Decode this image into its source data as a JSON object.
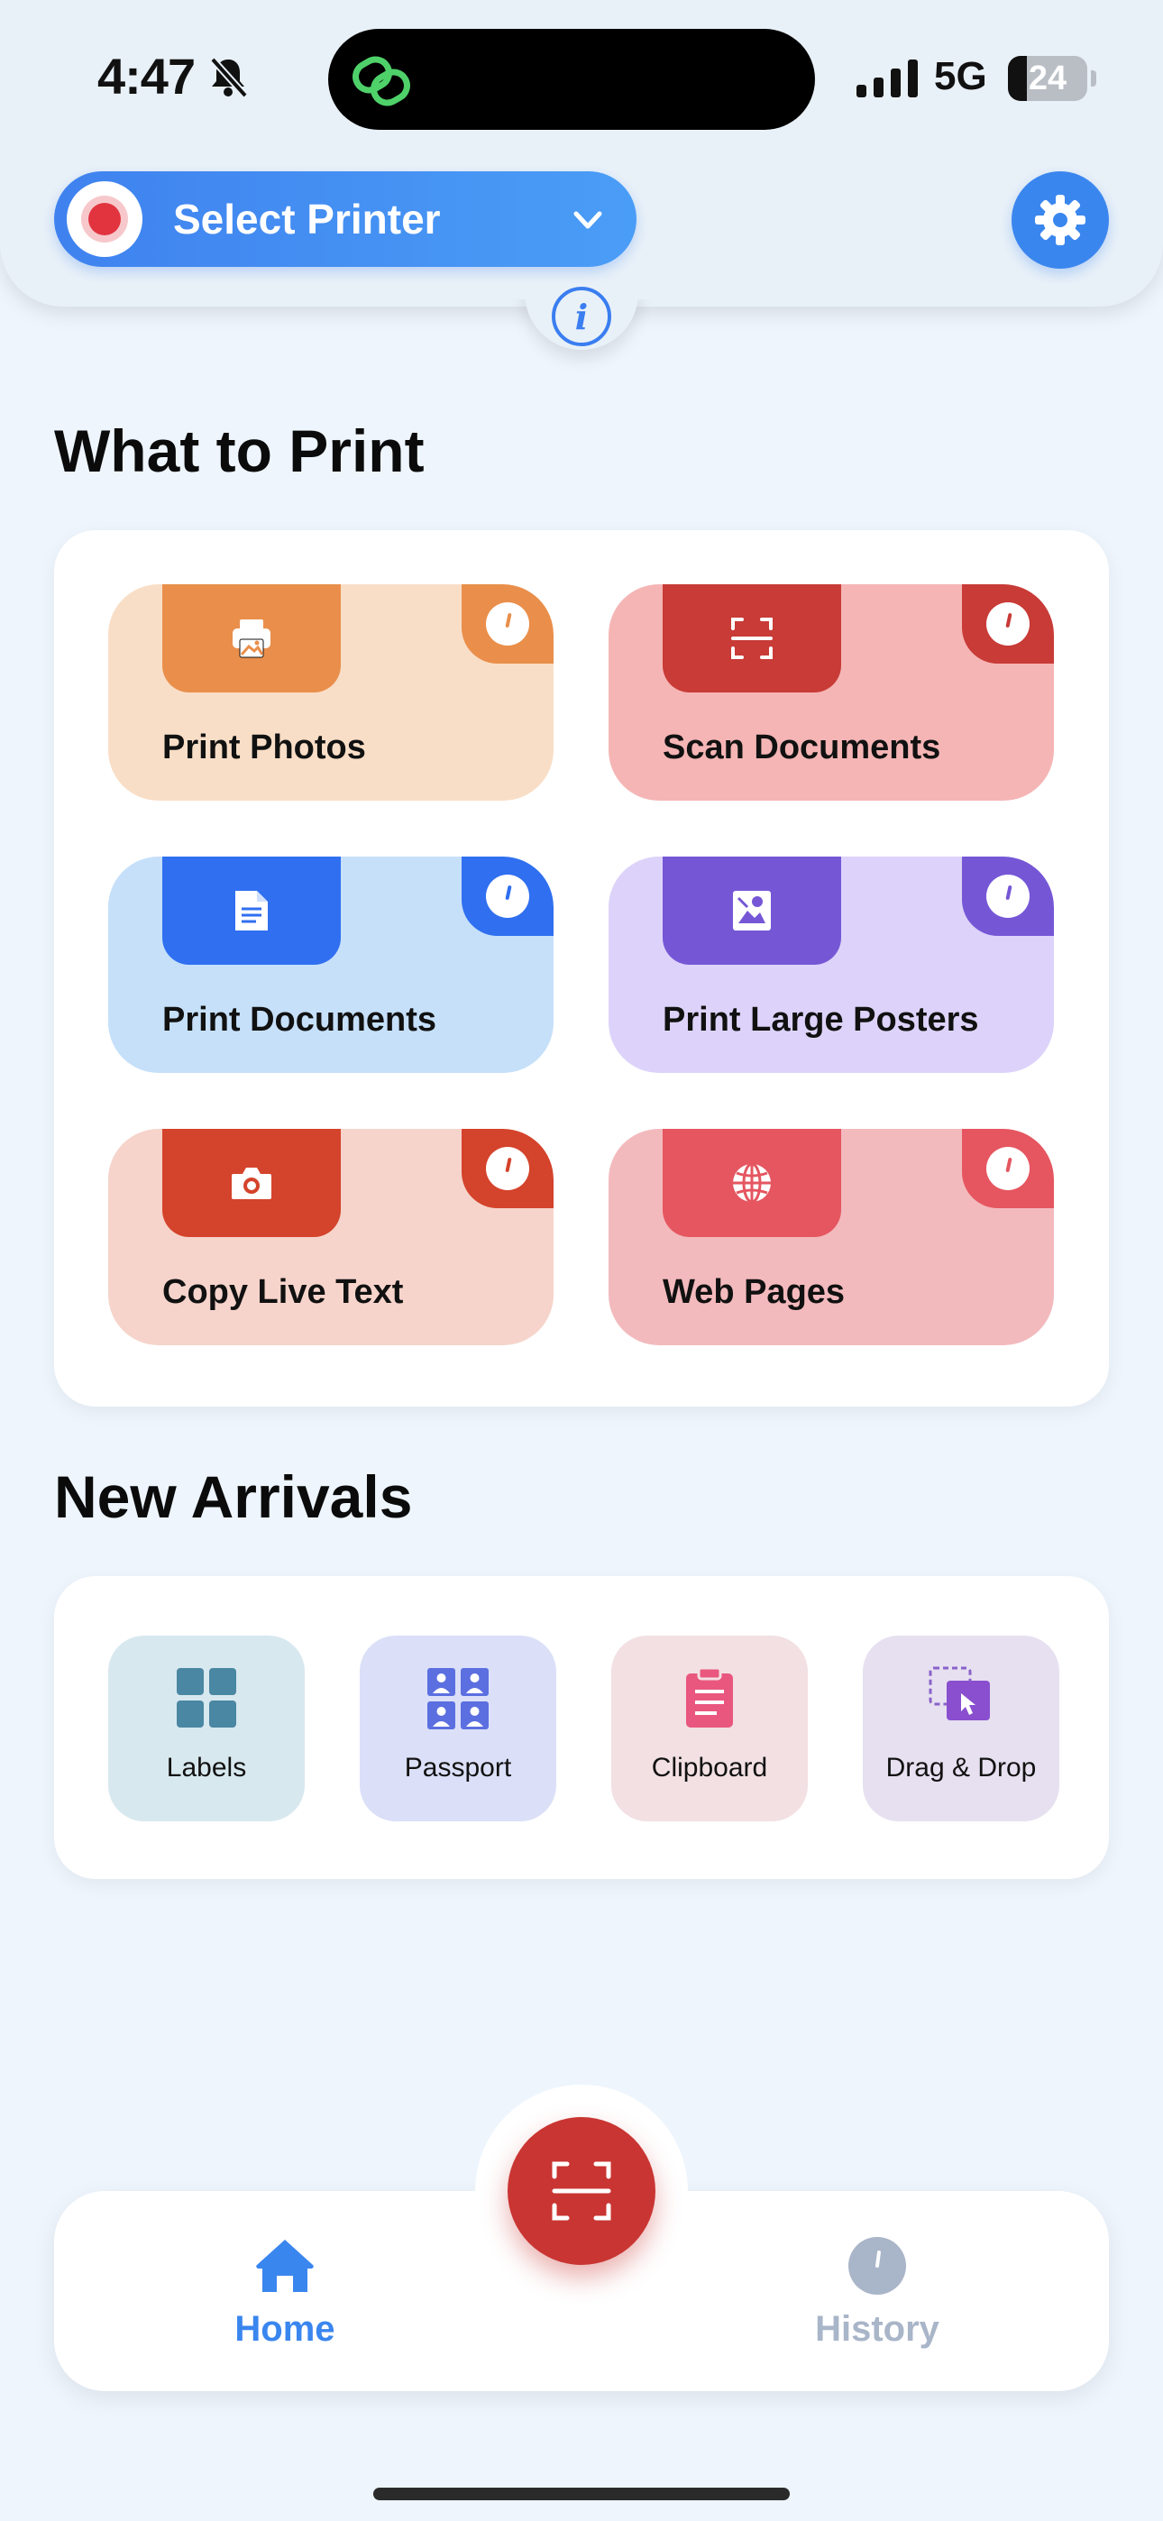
{
  "status_bar": {
    "time": "4:47",
    "network": "5G",
    "battery": "24"
  },
  "header": {
    "printer_label": "Select Printer"
  },
  "what_to_print": {
    "title": "What to Print",
    "cards": [
      {
        "label": "Print Photos",
        "icon": "printer-photo-icon",
        "bg": "#f9dec7",
        "accent": "#e98f4b"
      },
      {
        "label": "Scan Documents",
        "icon": "scan-icon",
        "bg": "#f5b5b5",
        "accent": "#c83b37"
      },
      {
        "label": "Print Documents",
        "icon": "document-icon",
        "bg": "#c6e0fa",
        "accent": "#2f6ff0"
      },
      {
        "label": "Print Large Posters",
        "icon": "poster-icon",
        "bg": "#ddd3fa",
        "accent": "#7557d6"
      },
      {
        "label": "Copy Live Text",
        "icon": "camera-icon",
        "bg": "#f6d4cb",
        "accent": "#d4432b"
      },
      {
        "label": "Web Pages",
        "icon": "globe-icon",
        "bg": "#f3babd",
        "accent": "#e55660"
      }
    ]
  },
  "new_arrivals": {
    "title": "New Arrivals",
    "items": [
      {
        "label": "Labels",
        "icon": "grid-icon",
        "bg": "#d8e8ef"
      },
      {
        "label": "Passport",
        "icon": "passport-icon",
        "bg": "#dbe0f8"
      },
      {
        "label": "Clipboard",
        "icon": "clipboard-icon",
        "bg": "#f2e0e3"
      },
      {
        "label": "Drag & Drop",
        "icon": "drag-drop-icon",
        "bg": "#e6e0f0"
      }
    ]
  },
  "bottom_nav": {
    "home_label": "Home",
    "history_label": "History",
    "active_color": "#3a86ef",
    "inactive_color": "#a9b5c8"
  }
}
